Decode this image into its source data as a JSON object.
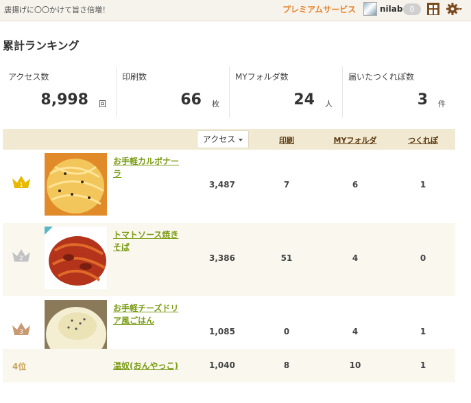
{
  "header": {
    "tagline": "唐揚げに〇〇かけて旨さ倍増！",
    "premium_label": "プレミアムサービス",
    "username": "nilab",
    "notification_count": "0"
  },
  "panel": {
    "title": "累計ランキング"
  },
  "stats": [
    {
      "label": "アクセス数",
      "value": "8,998",
      "unit": "回"
    },
    {
      "label": "印刷数",
      "value": "66",
      "unit": "枚"
    },
    {
      "label": "MYフォルダ数",
      "value": "24",
      "unit": "人"
    },
    {
      "label": "届いたつくれぽ数",
      "value": "3",
      "unit": "件"
    }
  ],
  "table": {
    "sort_label": "アクセス",
    "columns": [
      "印刷",
      "MYフォルダ",
      "つくれぽ"
    ],
    "rows": [
      {
        "rank": "1",
        "title": "お手軽カルボナーラ",
        "access": "3,487",
        "print": "7",
        "myfolder": "6",
        "tsukurepo": "1"
      },
      {
        "rank": "2",
        "title": "トマトソース焼きそば",
        "access": "3,386",
        "print": "51",
        "myfolder": "4",
        "tsukurepo": "0"
      },
      {
        "rank": "3",
        "title": "お手軽チーズドリア風ごはん",
        "access": "1,085",
        "print": "0",
        "myfolder": "4",
        "tsukurepo": "1"
      },
      {
        "rank": "4位",
        "title": "温奴(おんやっこ)",
        "access": "1,040",
        "print": "8",
        "myfolder": "10",
        "tsukurepo": "1"
      }
    ]
  },
  "colors": {
    "accent": "#e8832a",
    "link": "#7a9c15",
    "gold": "#e9b800",
    "silver": "#c2c2c2",
    "bronze": "#c89a72"
  }
}
